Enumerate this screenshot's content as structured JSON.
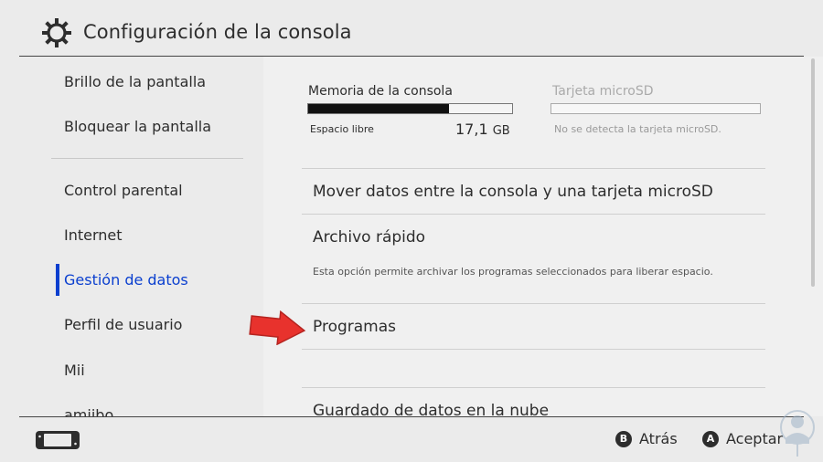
{
  "header": {
    "title": "Configuración de la consola",
    "icon": "gear-icon"
  },
  "sidebar": {
    "items": [
      {
        "label": "Brillo de la pantalla"
      },
      {
        "label": "Bloquear la pantalla"
      },
      {
        "label": "Control parental"
      },
      {
        "label": "Internet"
      },
      {
        "label": "Gestión de datos",
        "active": true
      },
      {
        "label": "Perfil de usuario"
      },
      {
        "label": "Mii"
      },
      {
        "label": "amiibo"
      }
    ]
  },
  "storage": {
    "console": {
      "title": "Memoria de la consola",
      "free_label": "Espacio libre",
      "free_value": "17,1",
      "free_unit": "GB",
      "used_fraction": 0.69
    },
    "microsd": {
      "title": "Tarjeta microSD",
      "status": "No se detecta la tarjeta microSD."
    }
  },
  "menu": {
    "move_data": "Mover datos entre la consola y una tarjeta microSD",
    "quick_archive": "Archivo rápido",
    "quick_archive_desc": "Esta opción permite archivar los programas seleccionados para liberar espacio.",
    "programs": "Programas",
    "cloud_save": "Guardado de datos en la nube"
  },
  "footer": {
    "back": {
      "button": "B",
      "label": "Atrás"
    },
    "accept": {
      "button": "A",
      "label": "Aceptar"
    }
  },
  "colors": {
    "accent": "#0a3fcf",
    "arrow": "#e8322d",
    "background": "#ebebeb"
  }
}
